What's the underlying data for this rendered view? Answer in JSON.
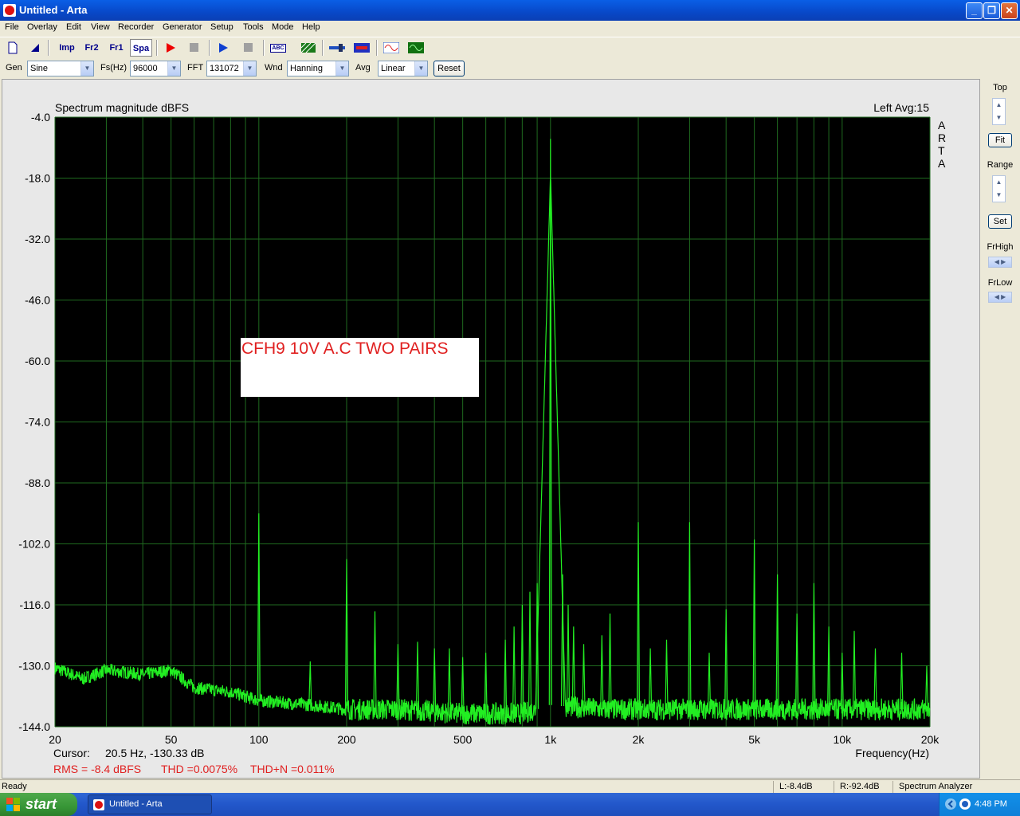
{
  "window": {
    "title": "Untitled - Arta"
  },
  "menu": [
    "File",
    "Overlay",
    "Edit",
    "View",
    "Recorder",
    "Generator",
    "Setup",
    "Tools",
    "Mode",
    "Help"
  ],
  "toolbar": {
    "imp": "Imp",
    "fr2": "Fr2",
    "fr1": "Fr1",
    "spa": "Spa",
    "abc": "ABC"
  },
  "controls": {
    "gen_label": "Gen",
    "gen_value": "Sine",
    "fs_label": "Fs(Hz)",
    "fs_value": "96000",
    "fft_label": "FFT",
    "fft_value": "131072",
    "wnd_label": "Wnd",
    "wnd_value": "Hanning",
    "avg_label": "Avg",
    "avg_value": "Linear",
    "reset": "Reset"
  },
  "right_panel": {
    "top": "Top",
    "fit": "Fit",
    "range": "Range",
    "set": "Set",
    "frhigh": "FrHigh",
    "frlow": "FrLow"
  },
  "plot": {
    "title": "Spectrum magnitude dBFS",
    "channel_info": "Left  Avg:15",
    "watermark": [
      "A",
      "R",
      "T",
      "A"
    ],
    "annotation": "CFH9 10V A.C TWO PAIRS",
    "cursor_label": "Cursor:",
    "cursor_value": "20.5 Hz, -130.33 dB",
    "freq_axis_label": "Frequency(Hz)",
    "rms": "RMS =   -8.4 dBFS",
    "thd": "THD =0.0075%",
    "thdn": "THD+N =0.011%"
  },
  "chart_data": {
    "type": "line",
    "title": "Spectrum magnitude dBFS",
    "xlabel": "Frequency(Hz)",
    "ylabel": "",
    "xscale": "log",
    "xlim": [
      20,
      20000
    ],
    "ylim": [
      -144,
      -4
    ],
    "x_ticks": [
      20,
      50,
      100,
      200,
      500,
      1000,
      2000,
      5000,
      10000,
      20000
    ],
    "x_tick_labels": [
      "20",
      "50",
      "100",
      "200",
      "500",
      "1k",
      "2k",
      "5k",
      "10k",
      "20k"
    ],
    "y_ticks": [
      -4,
      -18,
      -32,
      -46,
      -60,
      -74,
      -88,
      -102,
      -116,
      -130,
      -144
    ],
    "y_tick_labels": [
      "-4.0",
      "-18.0",
      "-32.0",
      "-46.0",
      "-60.0",
      "-74.0",
      "-88.0",
      "-102.0",
      "-116.0",
      "-130.0",
      "-144.0"
    ],
    "grid": true,
    "line_color": "#22EE22",
    "background": "#000000",
    "noise_floor": [
      [
        20,
        -130.5
      ],
      [
        25,
        -133
      ],
      [
        30,
        -131
      ],
      [
        40,
        -132
      ],
      [
        50,
        -131
      ],
      [
        60,
        -135
      ],
      [
        80,
        -136
      ],
      [
        100,
        -138
      ],
      [
        150,
        -139
      ],
      [
        200,
        -140
      ],
      [
        300,
        -140
      ],
      [
        500,
        -141
      ],
      [
        800,
        -141
      ],
      [
        1000,
        -139
      ],
      [
        1500,
        -140
      ],
      [
        2000,
        -140
      ],
      [
        5000,
        -140
      ],
      [
        10000,
        -140
      ],
      [
        20000,
        -140
      ]
    ],
    "peaks": [
      {
        "f": 1000,
        "db": -9.0
      },
      {
        "f": 100,
        "db": -95.0
      },
      {
        "f": 150,
        "db": -129.0
      },
      {
        "f": 200,
        "db": -105.5
      },
      {
        "f": 250,
        "db": -117.5
      },
      {
        "f": 300,
        "db": -125.0
      },
      {
        "f": 350,
        "db": -124.5
      },
      {
        "f": 400,
        "db": -126.0
      },
      {
        "f": 450,
        "db": -126.0
      },
      {
        "f": 500,
        "db": -128.0
      },
      {
        "f": 600,
        "db": -127.0
      },
      {
        "f": 700,
        "db": -124.0
      },
      {
        "f": 750,
        "db": -121.0
      },
      {
        "f": 800,
        "db": -116.0
      },
      {
        "f": 850,
        "db": -113.0
      },
      {
        "f": 900,
        "db": -111.0
      },
      {
        "f": 1100,
        "db": -109.0
      },
      {
        "f": 1150,
        "db": -116.0
      },
      {
        "f": 1200,
        "db": -121.0
      },
      {
        "f": 1300,
        "db": -125.0
      },
      {
        "f": 1500,
        "db": -123.0
      },
      {
        "f": 1600,
        "db": -118.0
      },
      {
        "f": 2000,
        "db": -97.0
      },
      {
        "f": 2200,
        "db": -126.0
      },
      {
        "f": 2500,
        "db": -124.0
      },
      {
        "f": 3000,
        "db": -97.0
      },
      {
        "f": 3500,
        "db": -127.0
      },
      {
        "f": 4000,
        "db": -117.0
      },
      {
        "f": 5000,
        "db": -101.0
      },
      {
        "f": 6000,
        "db": -109.0
      },
      {
        "f": 7000,
        "db": -118.0
      },
      {
        "f": 8000,
        "db": -111.0
      },
      {
        "f": 9000,
        "db": -121.0
      },
      {
        "f": 10000,
        "db": -127.0
      },
      {
        "f": 11000,
        "db": -122.0
      },
      {
        "f": 13000,
        "db": -126.0
      },
      {
        "f": 16000,
        "db": -127.0
      },
      {
        "f": 19500,
        "db": -130.0
      }
    ]
  },
  "status": {
    "ready": "Ready",
    "left": "L:-8.4dB",
    "right": "R:-92.4dB",
    "mode": "Spectrum Analyzer"
  },
  "taskbar": {
    "start": "start",
    "task": "Untitled - Arta",
    "clock": "4:48 PM"
  }
}
